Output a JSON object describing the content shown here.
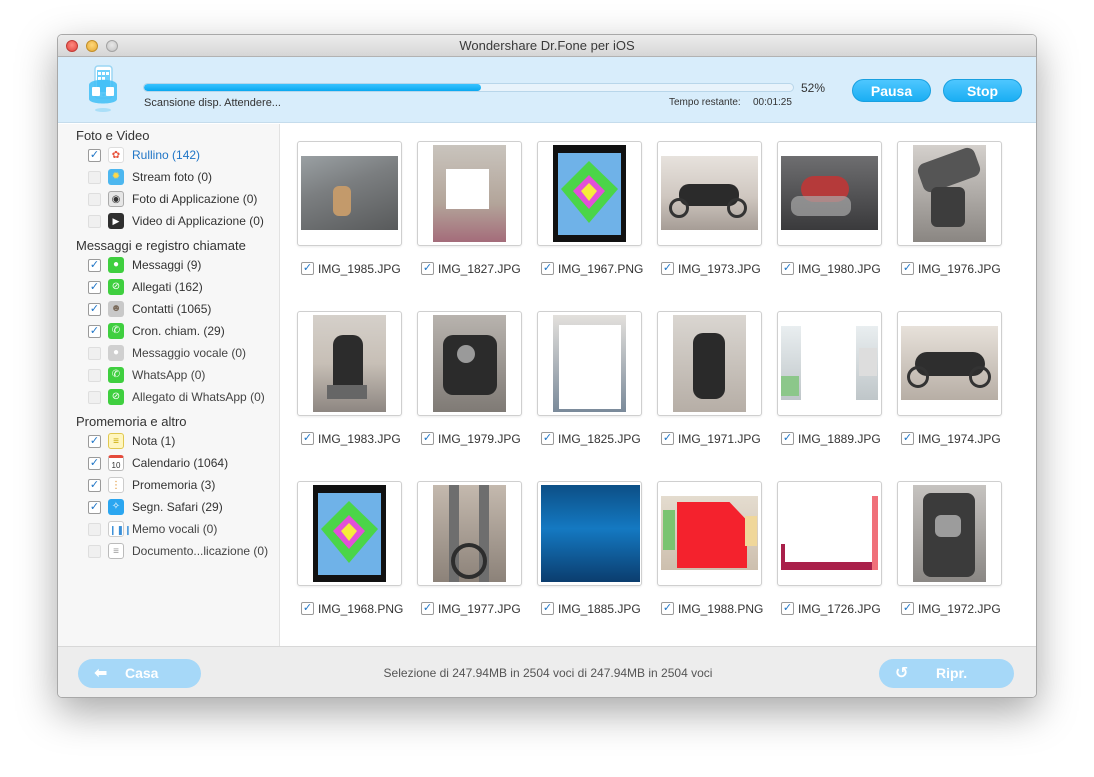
{
  "window": {
    "title": "Wondershare Dr.Fone per iOS"
  },
  "header": {
    "progress_percent": 52,
    "progress_label": "52%",
    "status": "Scansione disp. Attendere...",
    "time_label": "Tempo restante:",
    "time_value": "00:01:25",
    "pause_label": "Pausa",
    "stop_label": "Stop",
    "device_icon": "iphone-icon"
  },
  "sidebar": {
    "sections": [
      {
        "title": "Foto e Video"
      },
      {
        "title": "Messaggi e registro chiamate"
      },
      {
        "title": "Promemoria e altro"
      }
    ],
    "items": [
      {
        "label": "Rullino (142)",
        "checked": true,
        "icon": "photos-icon"
      },
      {
        "label": "Stream foto (0)",
        "checked": false,
        "icon": "photo-stream-icon"
      },
      {
        "label": "Foto di Applicazione (0)",
        "checked": false,
        "icon": "camera-icon"
      },
      {
        "label": "Video di Applicazione (0)",
        "checked": false,
        "icon": "video-icon"
      },
      {
        "label": "Messaggi (9)",
        "checked": true,
        "icon": "messages-icon"
      },
      {
        "label": "Allegati (162)",
        "checked": true,
        "icon": "attachment-icon"
      },
      {
        "label": "Contatti (1065)",
        "checked": true,
        "icon": "contacts-icon"
      },
      {
        "label": "Cron. chiam. (29)",
        "checked": true,
        "icon": "phone-icon"
      },
      {
        "label": "Messaggio vocale (0)",
        "checked": false,
        "icon": "microphone-icon"
      },
      {
        "label": "WhatsApp (0)",
        "checked": false,
        "icon": "whatsapp-icon"
      },
      {
        "label": "Allegato di WhatsApp (0)",
        "checked": false,
        "icon": "whatsapp-attachment-icon"
      },
      {
        "label": "Nota (1)",
        "checked": true,
        "icon": "notes-icon"
      },
      {
        "label": "Calendario (1064)",
        "checked": true,
        "icon": "calendar-icon"
      },
      {
        "label": "Promemoria (3)",
        "checked": true,
        "icon": "reminders-icon"
      },
      {
        "label": "Segn. Safari (29)",
        "checked": true,
        "icon": "safari-icon"
      },
      {
        "label": "Memo vocali (0)",
        "checked": false,
        "icon": "voice-memo-icon"
      },
      {
        "label": "Documento...licazione (0)",
        "checked": false,
        "icon": "document-icon"
      }
    ],
    "calendar_day": "10"
  },
  "photos": [
    {
      "name": "IMG_1985.JPG",
      "checked": true
    },
    {
      "name": "IMG_1827.JPG",
      "checked": true
    },
    {
      "name": "IMG_1967.PNG",
      "checked": true
    },
    {
      "name": "IMG_1973.JPG",
      "checked": true
    },
    {
      "name": "IMG_1980.JPG",
      "checked": true
    },
    {
      "name": "IMG_1976.JPG",
      "checked": true
    },
    {
      "name": "IMG_1983.JPG",
      "checked": true
    },
    {
      "name": "IMG_1979.JPG",
      "checked": true
    },
    {
      "name": "IMG_1825.JPG",
      "checked": true
    },
    {
      "name": "IMG_1971.JPG",
      "checked": true
    },
    {
      "name": "IMG_1889.JPG",
      "checked": true
    },
    {
      "name": "IMG_1974.JPG",
      "checked": true
    },
    {
      "name": "IMG_1968.PNG",
      "checked": true
    },
    {
      "name": "IMG_1977.JPG",
      "checked": true
    },
    {
      "name": "IMG_1885.JPG",
      "checked": true
    },
    {
      "name": "IMG_1988.PNG",
      "checked": true
    },
    {
      "name": "IMG_1726.JPG",
      "checked": true
    },
    {
      "name": "IMG_1972.JPG",
      "checked": true
    }
  ],
  "footer": {
    "home_label": "Casa",
    "restore_label": "Ripr.",
    "selection_text": "Selezione di 247.94MB in 2504 voci di 247.94MB in 2504 voci"
  },
  "colors": {
    "accent": "#1aaef3",
    "header_bg": "#d8edfb",
    "button_disabled": "#a6d8f8"
  }
}
